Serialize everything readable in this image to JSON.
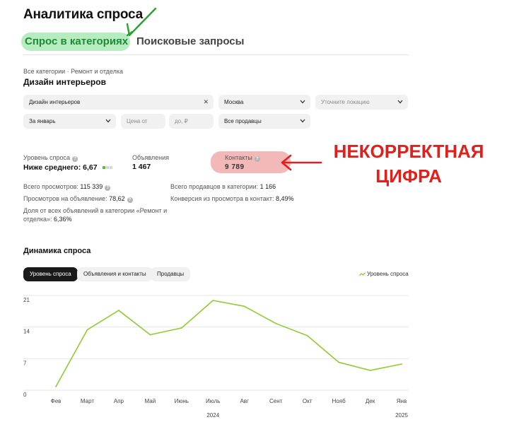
{
  "page": {
    "title": "Аналитика спроса"
  },
  "tabs": [
    {
      "label": "Спрос в категориях",
      "active": true
    },
    {
      "label": "Поисковые запросы",
      "active": false
    }
  ],
  "breadcrumb": "Все категории · Ремонт и отделка",
  "section_title": "Дизайн интерьеров",
  "filters": {
    "category": {
      "value": "Дизайн интерьеров",
      "icon": "close-icon"
    },
    "city": {
      "value": "Москва",
      "icon": "chevron-down-icon"
    },
    "location": {
      "placeholder": "Уточните локацию",
      "icon": "chevron-down-icon"
    },
    "period": {
      "value": "За январь",
      "icon": "chevron-down-icon"
    },
    "price_from": {
      "placeholder": "Цена от"
    },
    "price_to": {
      "placeholder": "до, ₽"
    },
    "sellers": {
      "value": "Все продавцы",
      "icon": "chevron-down-icon"
    }
  },
  "metrics": {
    "demand_label": "Уровень спроса",
    "demand_value": "Ниже среднего: 6,67",
    "demand_level": {
      "filled": 1,
      "total": 3,
      "on_color": "#55c03a",
      "off_color": "#d7d7d7"
    },
    "ads_label": "Объявления",
    "ads_value": "1 467",
    "contacts_label": "Контакты",
    "contacts_value": "9 789",
    "contacts_highlight": "#f3b9b9"
  },
  "stats": {
    "views_label": "Всего просмотров:",
    "views_value": "115 339",
    "views_per_ad_label": "Просмотров на объявление:",
    "views_per_ad_value": "78,62",
    "share_label_line1": "Доля от всех объявлений в категории «Ремонт и",
    "share_label_line2": "отделка»:",
    "share_value": "6,36%",
    "sellers_label": "Всего продавцов в категории:",
    "sellers_value": "1 166",
    "conversion_label": "Конверсия из просмотра в контакт:",
    "conversion_value": "8,49%"
  },
  "annotation": {
    "line1": "НЕКОРРЕКТНАЯ",
    "line2": "ЦИФРА",
    "color": "#e0201d"
  },
  "chart_section": {
    "title": "Динамика спроса",
    "tabs": [
      {
        "label": "Уровень спроса",
        "active": true
      },
      {
        "label": "Объявления и контакты",
        "active": false
      },
      {
        "label": "Продавцы",
        "active": false
      }
    ],
    "legend": "Уровень спроса"
  },
  "colors": {
    "accent_green": "#1f8a35",
    "tab_highlight": "#b5ecc0",
    "line": "#8dcc33"
  },
  "chart_data": {
    "type": "line",
    "categories": [
      "Фев",
      "Март",
      "Апр",
      "Май",
      "Июнь",
      "Июль",
      "Авг",
      "Сент",
      "Окт",
      "Нояб",
      "Дек",
      "Янв"
    ],
    "year_labels": [
      {
        "text": "2024",
        "under": "Июль"
      },
      {
        "text": "2025",
        "under": "Янв"
      }
    ],
    "series": [
      {
        "name": "Уровень спроса",
        "values": [
          0.8,
          13.4,
          17.7,
          12.3,
          13.8,
          19.9,
          18.6,
          14.8,
          12.1,
          6.2,
          4.4,
          5.8
        ]
      }
    ],
    "y_ticks": [
      0,
      7,
      14,
      21
    ],
    "ylim": [
      0,
      21
    ],
    "grid": true,
    "legend_position": "top-right"
  }
}
